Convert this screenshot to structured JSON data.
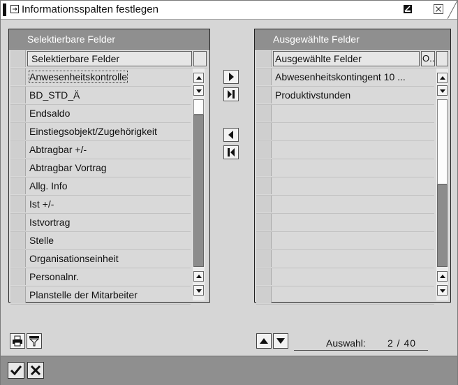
{
  "window": {
    "title": "Informationsspalten festlegen"
  },
  "left_panel": {
    "header": "Selektierbare Felder",
    "column_header": "Selektierbare Felder",
    "items": [
      "Anwesenheitskontrolle",
      "BD_STD_Ä",
      "Endsaldo",
      "Einstiegsobjekt/Zugehörigkeit",
      "Abtragbar +/-",
      "Abtragbar Vortrag",
      "Allg. Info",
      "Ist +/-",
      "Istvortrag",
      "Stelle",
      "Organisationseinheit",
      "Personalnr.",
      "Planstelle der Mitarbeiter"
    ]
  },
  "right_panel": {
    "header": "Ausgewählte Felder",
    "column_header": "Ausgewählte Felder",
    "column_header_2": "O..",
    "items": [
      "Abwesenheitskontingent 10 ...",
      "Produktivstunden"
    ]
  },
  "selection": {
    "label": "Auswahl:",
    "value": "2 / 40"
  },
  "icons": {
    "title": "window-icon",
    "minimize": "minimize-icon",
    "close": "close-icon",
    "move_right": "move-right-icon",
    "move_all_right": "move-all-right-icon",
    "move_left": "move-left-icon",
    "move_all_left": "move-all-left-icon",
    "print": "print-icon",
    "filter": "filter-icon",
    "up": "move-up-icon",
    "down": "move-down-icon",
    "ok": "checkmark-icon",
    "cancel": "cancel-icon"
  }
}
